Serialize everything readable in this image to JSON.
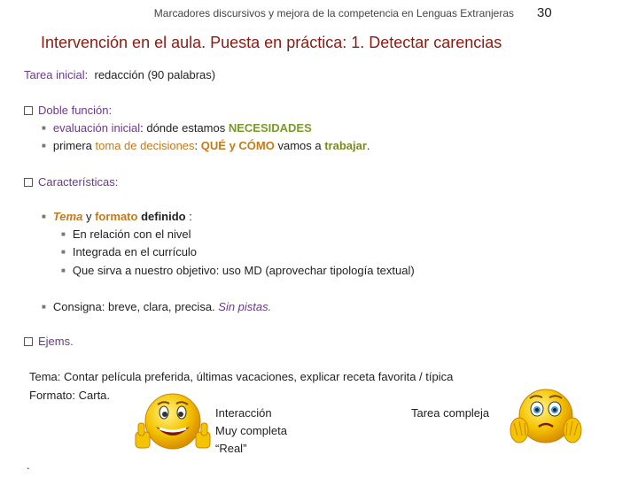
{
  "header": {
    "text": "Marcadores discursivos y mejora de la  competencia en Lenguas Extranjeras",
    "page_number": "30"
  },
  "title": "Intervención en el aula. Puesta en práctica: 1. Detectar carencias",
  "tarea_inicial": {
    "label": "Tarea inicial:",
    "value": "redacción  (90 palabras)"
  },
  "doble_funcion": {
    "label": "Doble función:",
    "items": [
      {
        "a": "evaluación inicial",
        "b": ": dónde estamos ",
        "c": "NECESIDADES"
      },
      {
        "a": "primera ",
        "b": "toma de decisiones",
        "c": ":  ",
        "d": "QUÉ y CÓMO",
        "e": " vamos a ",
        "f": "trabajar",
        "g": "."
      }
    ]
  },
  "caracteristicas": {
    "label": "Características:",
    "tema": {
      "a": "Tema",
      "b": " y ",
      "c": "formato",
      "d": " definido",
      "e": " :"
    },
    "subitems": [
      "En relación con el nivel",
      "Integrada en el currículo",
      "Que sirva a nuestro objetivo:  uso MD   (aprovechar tipología textual)"
    ],
    "consigna": {
      "a": "Consigna: breve, clara, precisa.  ",
      "b": "Sin pistas."
    }
  },
  "ejems": {
    "label": "Ejems.",
    "tema_line": "Tema: Contar película preferida,  últimas vacaciones, explicar receta favorita / típica",
    "formato_line": "Formato: Carta.",
    "interaccion": "Interacción",
    "muy_completa": "Muy completa",
    "real": "“Real”",
    "tarea_compleja": "Tarea compleja",
    "dot": "."
  },
  "icons": {
    "happy_face": "thumbs-up-smiley-icon",
    "worried_face": "worried-smiley-icon"
  },
  "colors": {
    "title": "#8b1a10",
    "purple": "#6a3a8a",
    "orange": "#c47a19",
    "green": "#7a9a2a"
  }
}
